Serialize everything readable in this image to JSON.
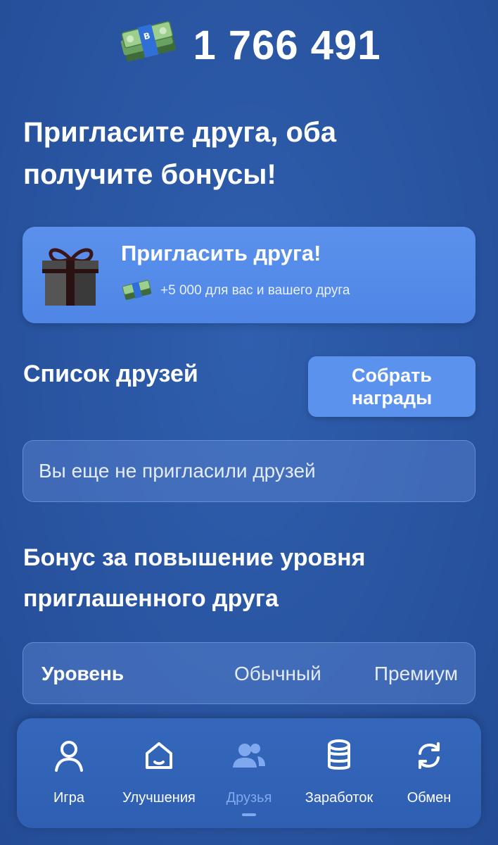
{
  "balance": {
    "value": "1 766 491",
    "icon": "cash-stack-icon"
  },
  "headline": "Пригласите друга, оба получите бонусы!",
  "invite": {
    "title": "Пригласить друга!",
    "subtitle": "+5 000 для вас и вашего друга",
    "icon": "gift-icon"
  },
  "friends": {
    "title": "Список друзей",
    "collect_label": "Собрать награды",
    "empty_text": "Вы еще не пригласили друзей"
  },
  "bonus": {
    "title": "Бонус за повышение уровня приглашенного друга",
    "level_label": "Уровень",
    "normal_label": "Обычный",
    "premium_label": "Премиум"
  },
  "nav": {
    "items": [
      {
        "label": "Игра",
        "icon": "user-icon",
        "active": false
      },
      {
        "label": "Улучшения",
        "icon": "home-icon",
        "active": false
      },
      {
        "label": "Друзья",
        "icon": "friends-icon",
        "active": true
      },
      {
        "label": "Заработок",
        "icon": "database-icon",
        "active": false
      },
      {
        "label": "Обмен",
        "icon": "exchange-icon",
        "active": false
      }
    ],
    "active_color": "#7fa8ee"
  },
  "colors": {
    "background": "#2a56a3",
    "invite_card": "#5b91ec",
    "button": "#5b92ee"
  }
}
